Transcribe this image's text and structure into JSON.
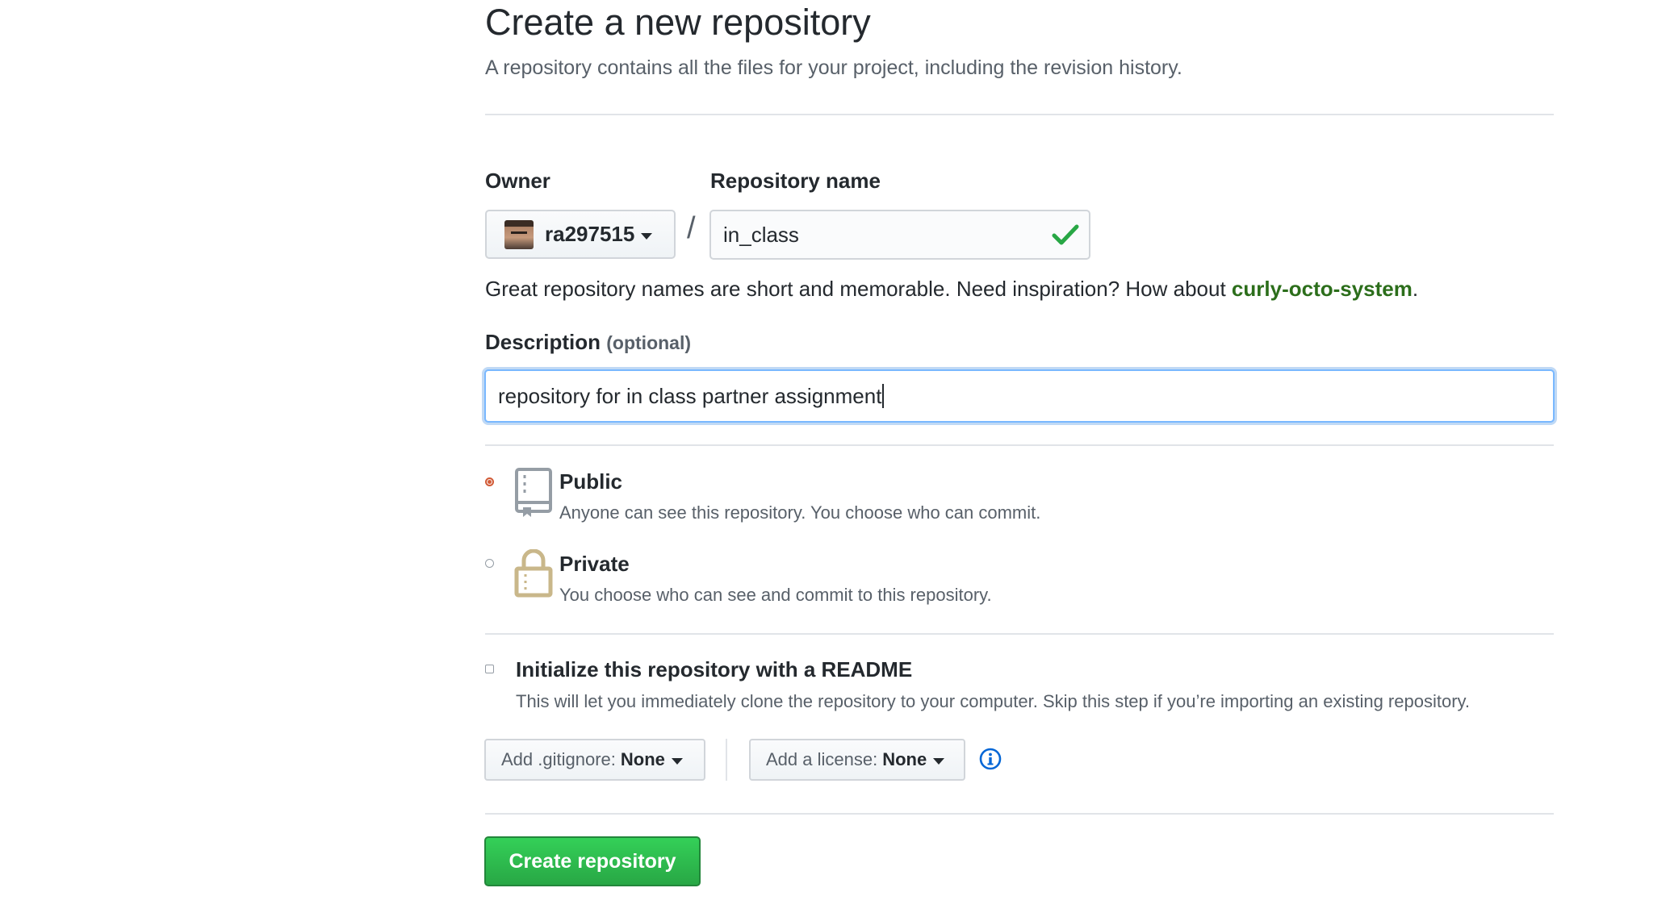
{
  "header": {
    "title": "Create a new repository",
    "subtitle": "A repository contains all the files for your project, including the revision history."
  },
  "owner": {
    "label": "Owner",
    "value": "ra297515"
  },
  "repo_name": {
    "label": "Repository name",
    "value": "in_class",
    "valid": true
  },
  "hint": {
    "prefix": "Great repository names are short and memorable. Need inspiration? How about ",
    "suggestion": "curly-octo-system",
    "suffix": "."
  },
  "description": {
    "label": "Description",
    "optional": "(optional)",
    "value": "repository for in class partner assignment"
  },
  "visibility": {
    "selected": "public",
    "public_title": "Public",
    "public_desc": "Anyone can see this repository. You choose who can commit.",
    "private_title": "Private",
    "private_desc": "You choose who can see and commit to this repository."
  },
  "readme": {
    "checked": false,
    "title": "Initialize this repository with a README",
    "desc": "This will let you immediately clone the repository to your computer. Skip this step if you’re importing an existing repository."
  },
  "gitignore": {
    "prefix": "Add .gitignore:",
    "value": "None"
  },
  "license": {
    "prefix": "Add a license:",
    "value": "None"
  },
  "create_button": "Create repository",
  "colors": {
    "primary_green": "#28a745",
    "suggestion_green": "#2c6e1b",
    "focus_blue": "#79b8ff",
    "radio_selected": "#d15a36",
    "info_blue": "#0366d6"
  },
  "icons": {
    "valid": "check-icon",
    "public": "repo-icon",
    "private": "lock-icon",
    "info": "info-icon",
    "dropdown": "chevron-down-icon"
  }
}
